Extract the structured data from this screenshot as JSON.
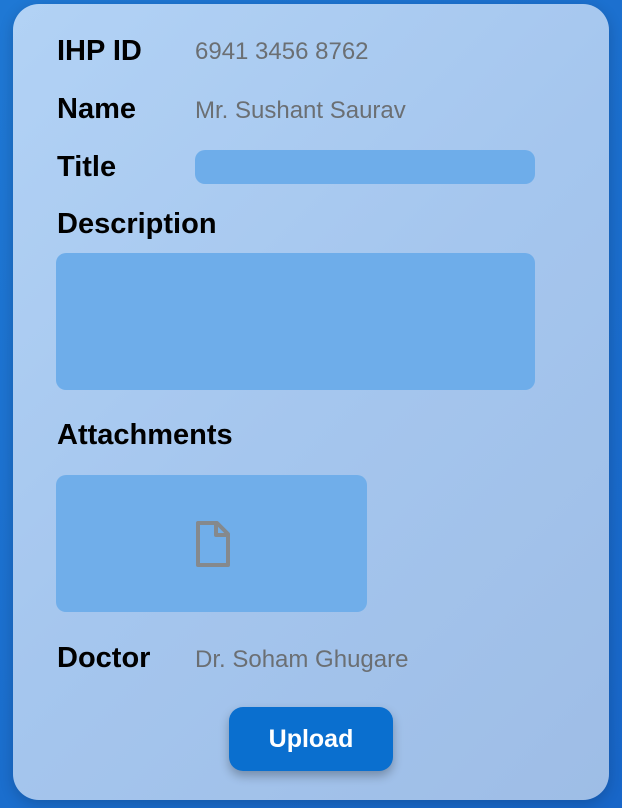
{
  "form": {
    "ihp_id_label": "IHP ID",
    "ihp_id_value": "6941 3456 8762",
    "name_label": "Name",
    "name_value": "Mr. Sushant Saurav",
    "title_label": "Title",
    "title_value": "",
    "description_label": "Description",
    "description_value": "",
    "attachments_label": "Attachments",
    "attachment_icon": "file-icon",
    "doctor_label": "Doctor",
    "doctor_value": "Dr. Soham Ghugare",
    "upload_label": "Upload"
  },
  "colors": {
    "background": "#1f78d4",
    "card": "#aacaf1",
    "field": "#6eadea",
    "button": "#0a6fcf",
    "value_text": "#6b6f73"
  }
}
